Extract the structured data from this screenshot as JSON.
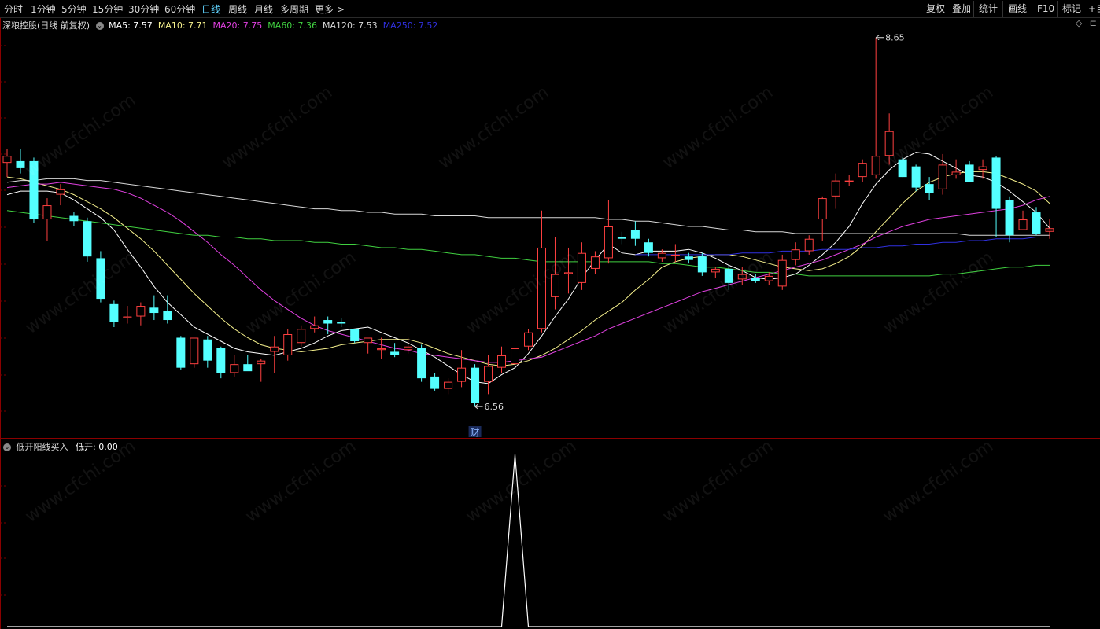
{
  "toolbar": {
    "tabs": [
      "分时",
      "1分钟",
      "5分钟",
      "15分钟",
      "30分钟",
      "60分钟",
      "日线",
      "周线",
      "月线",
      "多周期",
      "更多 >"
    ],
    "active_tab": "日线",
    "right_buttons": [
      "复权",
      "叠加",
      "统计",
      "画线",
      "F10",
      "标记",
      "+自"
    ]
  },
  "legend": {
    "title": "深粮控股(日线 前复权)",
    "items": [
      {
        "label": "MA5: 7.57",
        "color": "#ffffff"
      },
      {
        "label": "MA10: 7.71",
        "color": "#f5f08c"
      },
      {
        "label": "MA20: 7.75",
        "color": "#e040e0"
      },
      {
        "label": "MA60: 7.36",
        "color": "#40d040"
      },
      {
        "label": "MA120: 7.53",
        "color": "#d8d8d8"
      },
      {
        "label": "MA250: 7.52",
        "color": "#3030e0"
      }
    ]
  },
  "annotations": {
    "high": "8.65",
    "low": "6.56",
    "event_marker": "财"
  },
  "indicator": {
    "title": "低开阳线买入",
    "value_label": "低开: 0.00"
  },
  "watermark": "www.cfchi.com",
  "colors": {
    "up": "#ff4040",
    "down": "#54ffff",
    "background": "#000000",
    "grid": "#8b0000"
  },
  "chart_data": {
    "type": "candlestick",
    "price_range": [
      6.4,
      8.72
    ],
    "candles": [
      {
        "o": 7.94,
        "h": 8.02,
        "l": 7.86,
        "c": 7.98
      },
      {
        "o": 7.95,
        "h": 8.02,
        "l": 7.88,
        "c": 7.91
      },
      {
        "o": 7.95,
        "h": 7.97,
        "l": 7.6,
        "c": 7.62
      },
      {
        "o": 7.62,
        "h": 7.74,
        "l": 7.5,
        "c": 7.7
      },
      {
        "o": 7.76,
        "h": 7.82,
        "l": 7.7,
        "c": 7.79
      },
      {
        "o": 7.64,
        "h": 7.66,
        "l": 7.58,
        "c": 7.61
      },
      {
        "o": 7.61,
        "h": 7.63,
        "l": 7.38,
        "c": 7.41
      },
      {
        "o": 7.4,
        "h": 7.44,
        "l": 7.15,
        "c": 7.17
      },
      {
        "o": 7.14,
        "h": 7.16,
        "l": 7.01,
        "c": 7.04
      },
      {
        "o": 7.06,
        "h": 7.13,
        "l": 7.03,
        "c": 7.07
      },
      {
        "o": 7.07,
        "h": 7.15,
        "l": 7.02,
        "c": 7.13
      },
      {
        "o": 7.12,
        "h": 7.19,
        "l": 7.05,
        "c": 7.09
      },
      {
        "o": 7.1,
        "h": 7.19,
        "l": 7.03,
        "c": 7.05
      },
      {
        "o": 6.95,
        "h": 6.96,
        "l": 6.77,
        "c": 6.78
      },
      {
        "o": 6.8,
        "h": 6.92,
        "l": 6.78,
        "c": 6.95
      },
      {
        "o": 6.94,
        "h": 6.96,
        "l": 6.78,
        "c": 6.82
      },
      {
        "o": 6.89,
        "h": 6.9,
        "l": 6.72,
        "c": 6.75
      },
      {
        "o": 6.75,
        "h": 6.85,
        "l": 6.73,
        "c": 6.8
      },
      {
        "o": 6.8,
        "h": 6.85,
        "l": 6.78,
        "c": 6.76
      },
      {
        "o": 6.8,
        "h": 6.83,
        "l": 6.7,
        "c": 6.82
      },
      {
        "o": 6.87,
        "h": 6.96,
        "l": 6.75,
        "c": 6.9
      },
      {
        "o": 6.85,
        "h": 7.0,
        "l": 6.82,
        "c": 6.97
      },
      {
        "o": 6.92,
        "h": 7.02,
        "l": 6.9,
        "c": 7.0
      },
      {
        "o": 7.0,
        "h": 7.07,
        "l": 6.98,
        "c": 7.02
      },
      {
        "o": 7.05,
        "h": 7.07,
        "l": 6.97,
        "c": 7.03
      },
      {
        "o": 7.04,
        "h": 7.06,
        "l": 7.01,
        "c": 7.03
      },
      {
        "o": 7.0,
        "h": 7.0,
        "l": 6.92,
        "c": 6.93
      },
      {
        "o": 6.92,
        "h": 6.94,
        "l": 6.86,
        "c": 6.95
      },
      {
        "o": 6.88,
        "h": 6.95,
        "l": 6.83,
        "c": 6.89
      },
      {
        "o": 6.87,
        "h": 6.92,
        "l": 6.84,
        "c": 6.85
      },
      {
        "o": 6.88,
        "h": 6.95,
        "l": 6.86,
        "c": 6.9
      },
      {
        "o": 6.89,
        "h": 6.91,
        "l": 6.7,
        "c": 6.72
      },
      {
        "o": 6.73,
        "h": 6.75,
        "l": 6.65,
        "c": 6.66
      },
      {
        "o": 6.66,
        "h": 6.72,
        "l": 6.63,
        "c": 6.7
      },
      {
        "o": 6.7,
        "h": 6.88,
        "l": 6.67,
        "c": 6.78
      },
      {
        "o": 6.78,
        "h": 6.8,
        "l": 6.56,
        "c": 6.58
      },
      {
        "o": 6.7,
        "h": 6.85,
        "l": 6.63,
        "c": 6.79
      },
      {
        "o": 6.78,
        "h": 6.9,
        "l": 6.75,
        "c": 6.85
      },
      {
        "o": 6.8,
        "h": 6.93,
        "l": 6.79,
        "c": 6.89
      },
      {
        "o": 6.9,
        "h": 7.0,
        "l": 6.88,
        "c": 6.98
      },
      {
        "o": 7.0,
        "h": 7.67,
        "l": 6.98,
        "c": 7.46
      },
      {
        "o": 7.18,
        "h": 7.52,
        "l": 7.11,
        "c": 7.31
      },
      {
        "o": 7.31,
        "h": 7.46,
        "l": 7.2,
        "c": 7.32
      },
      {
        "o": 7.26,
        "h": 7.49,
        "l": 7.22,
        "c": 7.43
      },
      {
        "o": 7.34,
        "h": 7.44,
        "l": 7.31,
        "c": 7.41
      },
      {
        "o": 7.4,
        "h": 7.73,
        "l": 7.37,
        "c": 7.58
      },
      {
        "o": 7.52,
        "h": 7.55,
        "l": 7.48,
        "c": 7.51
      },
      {
        "o": 7.56,
        "h": 7.61,
        "l": 7.47,
        "c": 7.51
      },
      {
        "o": 7.49,
        "h": 7.51,
        "l": 7.41,
        "c": 7.43
      },
      {
        "o": 7.4,
        "h": 7.45,
        "l": 7.38,
        "c": 7.43
      },
      {
        "o": 7.42,
        "h": 7.48,
        "l": 7.38,
        "c": 7.42
      },
      {
        "o": 7.41,
        "h": 7.43,
        "l": 7.37,
        "c": 7.39
      },
      {
        "o": 7.41,
        "h": 7.43,
        "l": 7.3,
        "c": 7.32
      },
      {
        "o": 7.32,
        "h": 7.35,
        "l": 7.29,
        "c": 7.34
      },
      {
        "o": 7.34,
        "h": 7.36,
        "l": 7.22,
        "c": 7.26
      },
      {
        "o": 7.28,
        "h": 7.35,
        "l": 7.25,
        "c": 7.31
      },
      {
        "o": 7.29,
        "h": 7.31,
        "l": 7.26,
        "c": 7.27
      },
      {
        "o": 7.27,
        "h": 7.32,
        "l": 7.25,
        "c": 7.3
      },
      {
        "o": 7.24,
        "h": 7.42,
        "l": 7.22,
        "c": 7.39
      },
      {
        "o": 7.39,
        "h": 7.49,
        "l": 7.36,
        "c": 7.45
      },
      {
        "o": 7.44,
        "h": 7.53,
        "l": 7.42,
        "c": 7.51
      },
      {
        "o": 7.62,
        "h": 7.75,
        "l": 7.5,
        "c": 7.74
      },
      {
        "o": 7.75,
        "h": 7.88,
        "l": 7.68,
        "c": 7.84
      },
      {
        "o": 7.84,
        "h": 7.87,
        "l": 7.81,
        "c": 7.84
      },
      {
        "o": 7.86,
        "h": 7.96,
        "l": 7.83,
        "c": 7.94
      },
      {
        "o": 7.87,
        "h": 8.65,
        "l": 7.85,
        "c": 7.98
      },
      {
        "o": 7.98,
        "h": 8.22,
        "l": 7.93,
        "c": 8.12
      },
      {
        "o": 7.96,
        "h": 7.97,
        "l": 7.86,
        "c": 7.86
      },
      {
        "o": 7.92,
        "h": 7.93,
        "l": 7.78,
        "c": 7.8
      },
      {
        "o": 7.82,
        "h": 7.86,
        "l": 7.73,
        "c": 7.77
      },
      {
        "o": 7.79,
        "h": 7.99,
        "l": 7.76,
        "c": 7.93
      },
      {
        "o": 7.87,
        "h": 7.96,
        "l": 7.85,
        "c": 7.89
      },
      {
        "o": 7.93,
        "h": 7.95,
        "l": 7.83,
        "c": 7.83
      },
      {
        "o": 7.9,
        "h": 7.96,
        "l": 7.85,
        "c": 7.92
      },
      {
        "o": 7.97,
        "h": 7.98,
        "l": 7.52,
        "c": 7.68
      },
      {
        "o": 7.73,
        "h": 7.75,
        "l": 7.49,
        "c": 7.53
      },
      {
        "o": 7.56,
        "h": 7.67,
        "l": 7.56,
        "c": 7.62
      },
      {
        "o": 7.66,
        "h": 7.69,
        "l": 7.53,
        "c": 7.54
      },
      {
        "o": 7.55,
        "h": 7.62,
        "l": 7.51,
        "c": 7.57
      }
    ],
    "ma_series": [
      {
        "name": "MA5",
        "color": "#ffffff",
        "values": [
          7.76,
          7.78,
          7.78,
          7.78,
          7.77,
          7.73,
          7.68,
          7.63,
          7.56,
          7.45,
          7.35,
          7.24,
          7.15,
          7.08,
          7.01,
          6.97,
          6.93,
          6.89,
          6.87,
          6.86,
          6.85,
          6.87,
          6.89,
          6.92,
          6.96,
          6.99,
          7.0,
          7.01,
          6.98,
          6.95,
          6.92,
          6.88,
          6.84,
          6.79,
          6.74,
          6.7,
          6.69,
          6.74,
          6.78,
          6.86,
          6.96,
          7.07,
          7.17,
          7.29,
          7.39,
          7.48,
          7.43,
          7.42,
          7.44,
          7.44,
          7.44,
          7.45,
          7.43,
          7.4,
          7.36,
          7.33,
          7.29,
          7.28,
          7.29,
          7.31,
          7.36,
          7.42,
          7.49,
          7.58,
          7.71,
          7.82,
          7.9,
          7.96,
          8.0,
          7.99,
          7.95,
          7.91,
          7.87,
          7.86,
          7.83,
          7.78,
          7.72,
          7.66,
          7.57
        ]
      },
      {
        "name": "MA10",
        "color": "#f5f08c",
        "values": [
          7.86,
          7.85,
          7.83,
          7.81,
          7.79,
          7.76,
          7.72,
          7.68,
          7.63,
          7.57,
          7.51,
          7.44,
          7.36,
          7.28,
          7.2,
          7.13,
          7.06,
          7.0,
          6.95,
          6.91,
          6.89,
          6.88,
          6.87,
          6.88,
          6.89,
          6.91,
          6.92,
          6.93,
          6.94,
          6.94,
          6.94,
          6.92,
          6.89,
          6.86,
          6.84,
          6.82,
          6.8,
          6.79,
          6.8,
          6.82,
          6.85,
          6.89,
          6.94,
          6.99,
          7.05,
          7.1,
          7.15,
          7.22,
          7.28,
          7.35,
          7.38,
          7.4,
          7.41,
          7.42,
          7.42,
          7.41,
          7.39,
          7.37,
          7.35,
          7.34,
          7.33,
          7.34,
          7.37,
          7.41,
          7.47,
          7.55,
          7.63,
          7.71,
          7.78,
          7.83,
          7.86,
          7.88,
          7.89,
          7.89,
          7.88,
          7.85,
          7.82,
          7.78,
          7.71
        ]
      },
      {
        "name": "MA20",
        "color": "#e040e0",
        "values": [
          7.8,
          7.81,
          7.82,
          7.82,
          7.83,
          7.82,
          7.81,
          7.8,
          7.79,
          7.77,
          7.74,
          7.7,
          7.66,
          7.61,
          7.55,
          7.49,
          7.42,
          7.36,
          7.29,
          7.22,
          7.16,
          7.11,
          7.06,
          7.02,
          6.99,
          6.97,
          6.95,
          6.93,
          6.91,
          6.89,
          6.88,
          6.86,
          6.85,
          6.84,
          6.83,
          6.82,
          6.81,
          6.81,
          6.82,
          6.83,
          6.84,
          6.87,
          6.9,
          6.93,
          6.96,
          7.0,
          7.03,
          7.06,
          7.09,
          7.12,
          7.15,
          7.18,
          7.21,
          7.23,
          7.25,
          7.27,
          7.29,
          7.31,
          7.33,
          7.35,
          7.37,
          7.39,
          7.42,
          7.45,
          7.48,
          7.52,
          7.55,
          7.58,
          7.6,
          7.62,
          7.63,
          7.64,
          7.65,
          7.66,
          7.67,
          7.68,
          7.7,
          7.73,
          7.75
        ]
      },
      {
        "name": "MA60",
        "color": "#40d040",
        "values": [
          7.67,
          7.66,
          7.65,
          7.64,
          7.63,
          7.62,
          7.61,
          7.6,
          7.59,
          7.58,
          7.57,
          7.56,
          7.55,
          7.54,
          7.53,
          7.53,
          7.52,
          7.52,
          7.51,
          7.51,
          7.5,
          7.5,
          7.5,
          7.49,
          7.49,
          7.48,
          7.48,
          7.47,
          7.46,
          7.46,
          7.45,
          7.45,
          7.44,
          7.43,
          7.42,
          7.42,
          7.41,
          7.4,
          7.4,
          7.39,
          7.38,
          7.38,
          7.38,
          7.38,
          7.38,
          7.38,
          7.38,
          7.38,
          7.38,
          7.37,
          7.37,
          7.36,
          7.35,
          7.35,
          7.34,
          7.33,
          7.32,
          7.32,
          7.31,
          7.31,
          7.3,
          7.3,
          7.3,
          7.3,
          7.3,
          7.3,
          7.3,
          7.3,
          7.3,
          7.3,
          7.31,
          7.31,
          7.32,
          7.33,
          7.34,
          7.35,
          7.35,
          7.36,
          7.36
        ]
      },
      {
        "name": "MA120",
        "color": "#d8d8d8",
        "values": [
          7.83,
          7.84,
          7.84,
          7.85,
          7.85,
          7.85,
          7.84,
          7.84,
          7.83,
          7.82,
          7.81,
          7.8,
          7.79,
          7.78,
          7.77,
          7.76,
          7.75,
          7.74,
          7.73,
          7.72,
          7.71,
          7.7,
          7.69,
          7.68,
          7.68,
          7.67,
          7.67,
          7.66,
          7.66,
          7.65,
          7.65,
          7.65,
          7.64,
          7.64,
          7.64,
          7.64,
          7.63,
          7.63,
          7.63,
          7.63,
          7.63,
          7.63,
          7.63,
          7.63,
          7.63,
          7.62,
          7.62,
          7.61,
          7.61,
          7.6,
          7.59,
          7.58,
          7.58,
          7.57,
          7.56,
          7.56,
          7.55,
          7.55,
          7.55,
          7.54,
          7.54,
          7.54,
          7.54,
          7.54,
          7.54,
          7.54,
          7.54,
          7.54,
          7.54,
          7.54,
          7.54,
          7.54,
          7.53,
          7.53,
          7.53,
          7.53,
          7.53,
          7.53,
          7.53
        ]
      },
      {
        "name": "MA250",
        "color": "#3030e0",
        "values": [
          null,
          null,
          null,
          null,
          null,
          null,
          null,
          null,
          null,
          null,
          null,
          null,
          null,
          null,
          null,
          null,
          null,
          null,
          null,
          null,
          null,
          null,
          null,
          null,
          null,
          null,
          null,
          null,
          null,
          null,
          null,
          null,
          null,
          null,
          null,
          null,
          null,
          null,
          null,
          null,
          null,
          null,
          null,
          null,
          null,
          null,
          null,
          7.42,
          7.42,
          7.42,
          7.42,
          7.42,
          7.42,
          7.42,
          7.42,
          7.43,
          7.43,
          7.43,
          7.44,
          7.44,
          7.44,
          7.45,
          7.45,
          7.45,
          7.46,
          7.46,
          7.47,
          7.47,
          7.48,
          7.48,
          7.49,
          7.49,
          7.5,
          7.5,
          7.51,
          7.51,
          7.51,
          7.52,
          7.52
        ]
      }
    ],
    "indicator_series": {
      "name": "低开",
      "range": [
        0,
        1
      ],
      "values": [
        0,
        0,
        0,
        0,
        0,
        0,
        0,
        0,
        0,
        0,
        0,
        0,
        0,
        0,
        0,
        0,
        0,
        0,
        0,
        0,
        0,
        0,
        0,
        0,
        0,
        0,
        0,
        0,
        0,
        0,
        0,
        0,
        0,
        0,
        0,
        0,
        0,
        0,
        1,
        0,
        0,
        0,
        0,
        0,
        0,
        0,
        0,
        0,
        0,
        0,
        0,
        0,
        0,
        0,
        0,
        0,
        0,
        0,
        0,
        0,
        0,
        0,
        0,
        0,
        0,
        0,
        0,
        0,
        0,
        0,
        0,
        0,
        0,
        0,
        0,
        0,
        0,
        0,
        0
      ]
    }
  }
}
